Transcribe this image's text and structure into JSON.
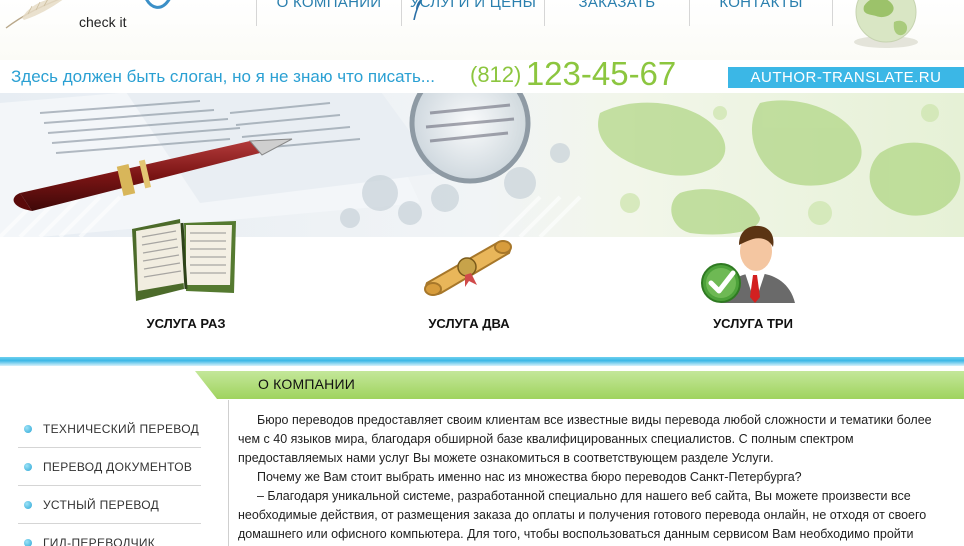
{
  "logo": {
    "tagline": "check it"
  },
  "nav": {
    "items": [
      {
        "label": "О КОМПАНИИ"
      },
      {
        "label": "УСЛУГИ И ЦЕНЫ"
      },
      {
        "label": "ЗАКАЗАТЬ"
      },
      {
        "label": "КОНТАКТЫ"
      }
    ]
  },
  "header": {
    "slogan": "Здесь должен быть слоган, но я не знаю что писать...",
    "phone_code": "(812)",
    "phone_number": "123-45-67",
    "site_name": "AUTHOR-TRANSLATE.RU"
  },
  "services": [
    {
      "label": "УСЛУГА РАЗ",
      "icon": "book-icon"
    },
    {
      "label": "УСЛУГА ДВА",
      "icon": "scroll-icon"
    },
    {
      "label": "УСЛУГА ТРИ",
      "icon": "person-check-icon"
    }
  ],
  "about": {
    "title": "О КОМПАНИИ",
    "paragraphs": [
      "Бюро переводов предоставляет своим клиентам все известные виды перевода любой сложности и тематики более чем с 40 языков мира, благодаря обширной базе квалифицированных специалистов. С полным спектром предоставляемых нами услуг Вы можете ознакомиться в соответствующем разделе Услуги.",
      "Почему же Вам стоит выбрать именно нас из множества бюро переводов Санкт-Петербурга?",
      "– Благодаря уникальной системе, разработанной специально для нашего веб сайта, Вы можете произвести все необходимые действия, от размещения заказа до оплаты и получения готового перевода онлайн, не отходя от своего домашнего или офисного компьютера. Для того, чтобы воспользоваться данным сервисом Вам необходимо пройти процесс"
    ]
  },
  "sidebar": {
    "items": [
      {
        "label": "ТЕХНИЧЕСКИЙ ПЕРЕВОД"
      },
      {
        "label": "ПЕРЕВОД ДОКУМЕНТОВ"
      },
      {
        "label": "УСТНЫЙ ПЕРЕВОД"
      },
      {
        "label": "ГИД-ПЕРЕВОДЧИК"
      }
    ]
  },
  "colors": {
    "accent_blue": "#3bb7e6",
    "nav_text": "#2a7fae",
    "phone_green": "#8cc63f",
    "header_green": "#a8d86a"
  }
}
